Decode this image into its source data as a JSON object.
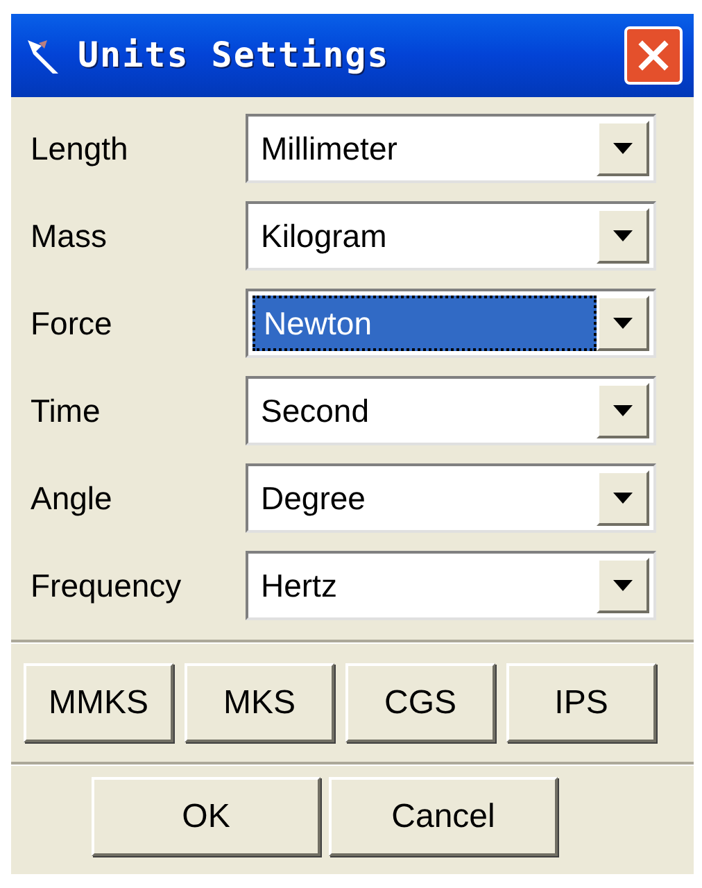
{
  "window": {
    "title": "Units Settings"
  },
  "fields": [
    {
      "label": "Length",
      "value": "Millimeter",
      "focused": false
    },
    {
      "label": "Mass",
      "value": "Kilogram",
      "focused": false
    },
    {
      "label": "Force",
      "value": "Newton",
      "focused": true
    },
    {
      "label": "Time",
      "value": "Second",
      "focused": false
    },
    {
      "label": "Angle",
      "value": "Degree",
      "focused": false
    },
    {
      "label": "Frequency",
      "value": "Hertz",
      "focused": false
    }
  ],
  "presets": [
    "MMKS",
    "MKS",
    "CGS",
    "IPS"
  ],
  "buttons": [
    "OK",
    "Cancel"
  ]
}
